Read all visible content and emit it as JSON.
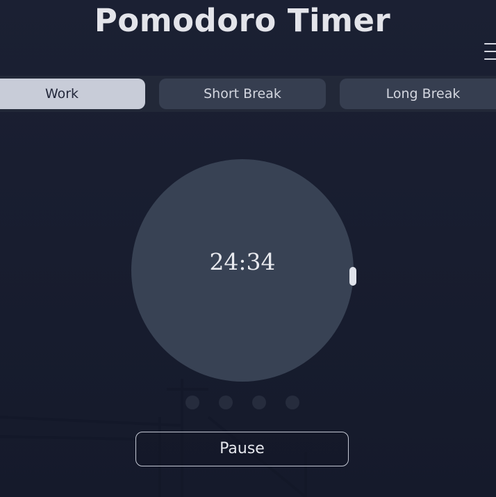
{
  "app": {
    "title": "Pomodoro Timer"
  },
  "tabs": [
    {
      "label": "Work",
      "active": true
    },
    {
      "label": "Short Break",
      "active": false
    },
    {
      "label": "Long Break",
      "active": false
    }
  ],
  "timer": {
    "remaining": "24:34"
  },
  "sessions": {
    "total": 4,
    "completed": 0
  },
  "controls": {
    "pause_label": "Pause"
  },
  "icons": {
    "menu": "hamburger-menu-icon"
  },
  "colors": {
    "background": "#181d2f",
    "tab_bar": "#222838",
    "tab_active": "#c8ccd8",
    "tab_inactive": "#363e50",
    "timer_circle": "#384254",
    "text_light": "#e3e4ea",
    "dot": "#262c3d"
  }
}
